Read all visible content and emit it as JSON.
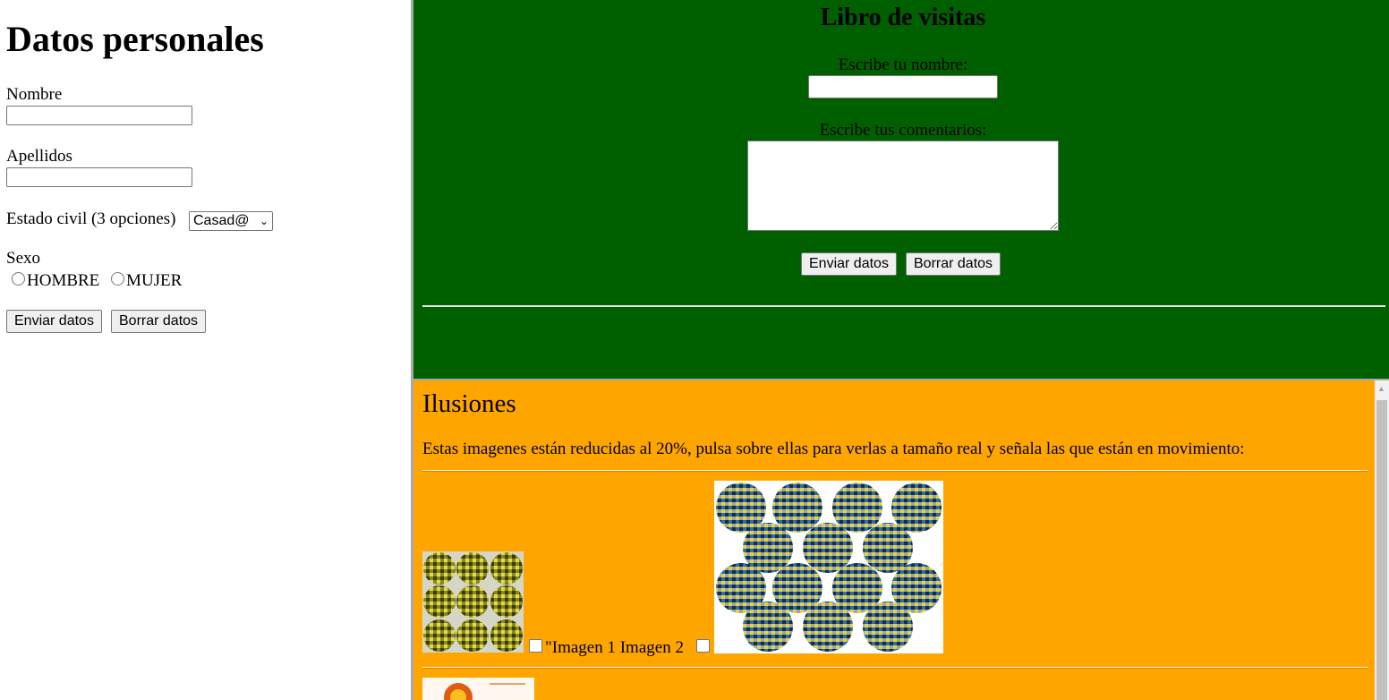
{
  "left": {
    "title": "Datos personales",
    "nombre_label": "Nombre",
    "apellidos_label": "Apellidos",
    "estado_label": "Estado civil (3 opciones)",
    "estado_value": "Casad@",
    "sexo_label": "Sexo",
    "radio1": "HOMBRE",
    "radio2": "MUJER",
    "submit": "Enviar datos",
    "reset": "Borrar datos"
  },
  "guestbook": {
    "title": "Libro de visitas",
    "name_label": "Escribe tu nombre:",
    "comments_label": "Escribe tus comentarios:",
    "submit": "Enviar datos",
    "reset": "Borrar datos",
    "bg_color": "#006000"
  },
  "illusions": {
    "title": "Ilusiones",
    "intro": "Estas imagenes están reducidas al 20%, pulsa sobre ellas para verlas a tamaño real y señala las que están en movimiento:",
    "caption": "\"Imagen 1 Imagen 2",
    "bg_color": "#ffa500"
  }
}
